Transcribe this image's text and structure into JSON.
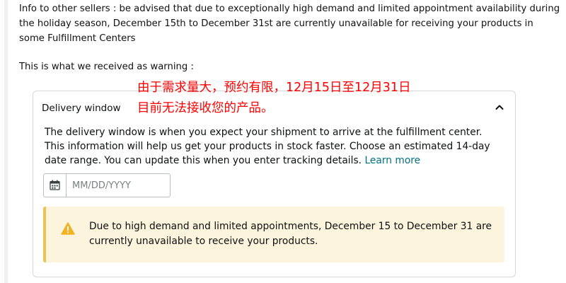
{
  "post": {
    "notice": "Info to other sellers : be advised that due to exceptionally high demand and limited appointment availability during the holiday season, December 15th to December 31st are currently unavailable for receiving your products in some Fulfillment Centers",
    "warning_intro": "This is what we received as warning :"
  },
  "annotation": {
    "text": "由于需求量大，预约有限，12月15日至12月31日\n目前无法接收您的产品。",
    "color": "#ff0000"
  },
  "delivery_window": {
    "title": "Delivery window",
    "expand_icon": "chevron-up-icon",
    "description": "The delivery window is when you expect your shipment to arrive at the fulfillment center. This information will help us get your products in stock faster. Choose an estimated 14-day date range. You can update this when you enter tracking details.",
    "learn_more": "Learn more",
    "date_input": {
      "placeholder": "MM/DD/YYYY",
      "value": "",
      "icon": "calendar-icon"
    },
    "alert": {
      "icon": "warning-icon",
      "message": "Due to high demand and limited appointments, December 15 to December 31 are currently unavailable to receive your products.",
      "accent_color": "#f2c14f",
      "background_color": "#fcf4dc"
    }
  },
  "colors": {
    "link": "#007185",
    "border": "#d5d9d9"
  }
}
